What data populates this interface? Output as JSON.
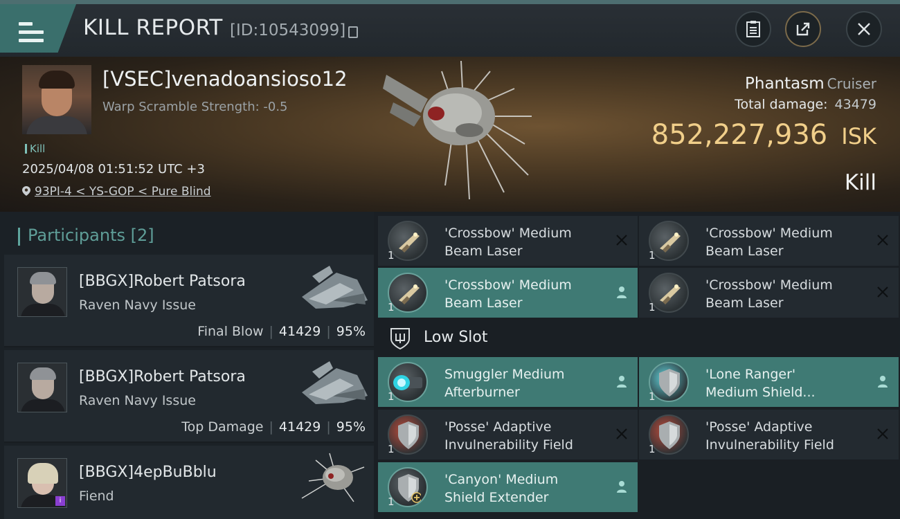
{
  "header": {
    "title": "KILL REPORT",
    "report_id": "[ID:10543099]",
    "icons": {
      "menu": "menu-icon",
      "copy": "copy-icon",
      "clipboard": "clipboard-icon",
      "share": "share-icon",
      "close": "close-icon"
    }
  },
  "victim": {
    "name": "[VSEC]venadoansioso12",
    "subline": "Warp Scramble Strength: -0.5",
    "tag": "Kill",
    "time": "2025/04/08 01:51:52 UTC +3",
    "location": "93PI-4 < YS-GOP < Pure Blind",
    "ship_name": "Phantasm",
    "ship_class": "Cruiser",
    "total_damage_label": "Total damage:",
    "total_damage": "43479",
    "isk_value": "852,227,936",
    "isk_unit": "ISK",
    "result": "Kill"
  },
  "participants": {
    "label": "Participants",
    "count": "[2]",
    "rows": [
      {
        "name": "[BBGX]Robert Patsora",
        "ship": "Raven Navy Issue",
        "stat_label": "Final Blow",
        "damage": "41429",
        "percent": "95%"
      },
      {
        "name": "[BBGX]Robert Patsora",
        "ship": "Raven Navy Issue",
        "stat_label": "Top Damage",
        "damage": "41429",
        "percent": "95%"
      },
      {
        "name": "[BBGX]4epBuBblu",
        "ship": "Fiend"
      }
    ]
  },
  "modules": {
    "low_slot_label": "Low Slot",
    "items": [
      {
        "name_l1": "'Crossbow' Medium",
        "name_l2": "Beam Laser",
        "qty": "1",
        "status": "destroyed"
      },
      {
        "name_l1": "'Crossbow' Medium",
        "name_l2": "Beam Laser",
        "qty": "1",
        "status": "destroyed"
      },
      {
        "name_l1": "'Crossbow' Medium",
        "name_l2": "Beam Laser",
        "qty": "1",
        "status": "dropped"
      },
      {
        "name_l1": "'Crossbow' Medium",
        "name_l2": "Beam Laser",
        "qty": "1",
        "status": "destroyed"
      },
      {
        "name_l1": "Smuggler Medium",
        "name_l2": "Afterburner",
        "qty": "1",
        "status": "dropped"
      },
      {
        "name_l1": "'Lone Ranger'",
        "name_l2": "Medium Shield...",
        "qty": "1",
        "status": "dropped"
      },
      {
        "name_l1": "'Posse' Adaptive",
        "name_l2": "Invulnerability Field",
        "qty": "1",
        "status": "destroyed"
      },
      {
        "name_l1": "'Posse' Adaptive",
        "name_l2": "Invulnerability Field",
        "qty": "1",
        "status": "destroyed"
      },
      {
        "name_l1": "'Canyon' Medium",
        "name_l2": "Shield Extender",
        "qty": "1",
        "status": "dropped"
      }
    ]
  },
  "colors": {
    "accent": "#3f7a74",
    "isk": "#f1cf8a",
    "header_accent": "#5f9e98"
  }
}
